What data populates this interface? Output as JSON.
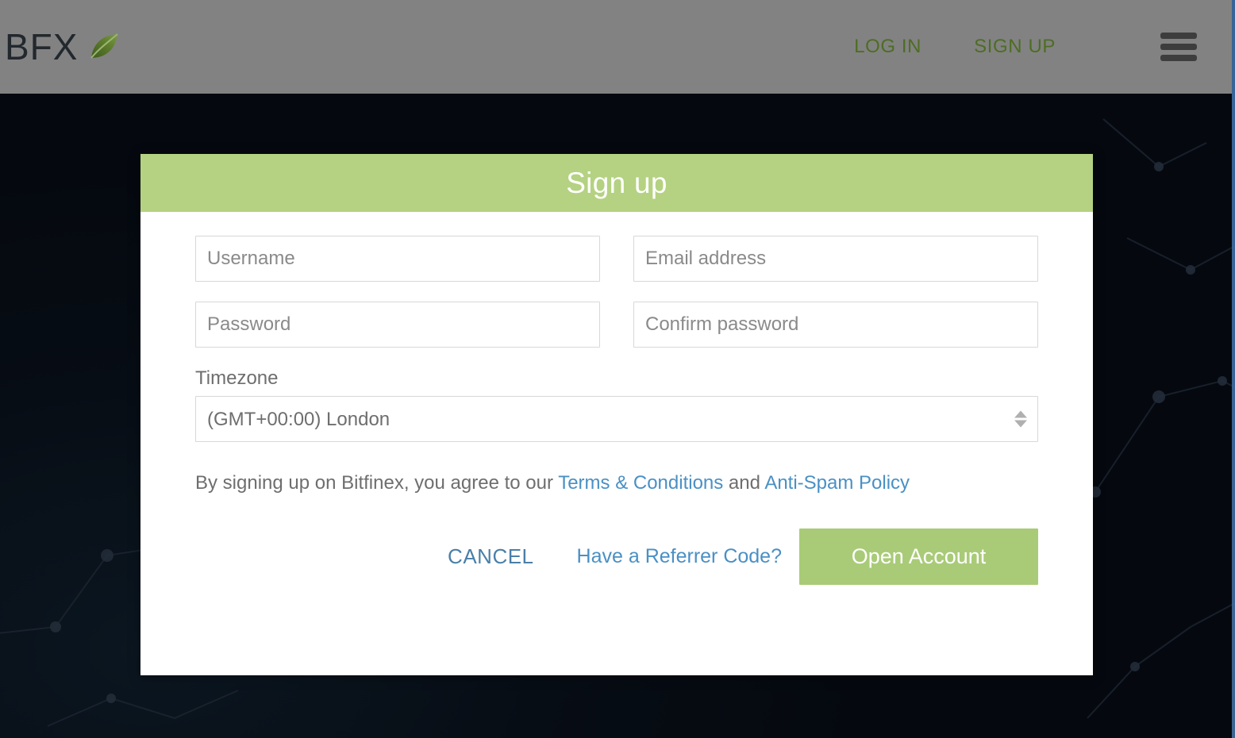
{
  "topbar": {
    "brand_text": "BFX",
    "brand_leaf_icon": "leaf-icon",
    "login_label": "LOG IN",
    "signup_label": "SIGN UP",
    "menu_icon": "hamburger-menu-icon",
    "background_color": "#828282",
    "link_color": "#4e6d23"
  },
  "modal": {
    "title": "Sign up",
    "header_color": "#b4d281",
    "fields": {
      "username_placeholder": "Username",
      "username_value": "",
      "email_placeholder": "Email address",
      "email_value": "",
      "password_placeholder": "Password",
      "password_value": "",
      "confirm_password_placeholder": "Confirm password",
      "confirm_password_value": "",
      "timezone_label": "Timezone",
      "timezone_value": "(GMT+00:00) London",
      "timezone_options": [
        "(GMT+00:00) London"
      ]
    },
    "terms": {
      "text_before": "By signing up on Bitfinex, you agree to our ",
      "terms_link": "Terms & Conditions",
      "text_between": " and ",
      "antispam_link": "Anti-Spam Policy",
      "link_color": "#4a90c4"
    },
    "actions": {
      "cancel_label": "CANCEL",
      "referrer_label": "Have a Referrer Code?",
      "open_account_label": "Open Account",
      "open_account_color": "#a9cb78"
    }
  },
  "background": {
    "base_color": "#060c14",
    "accent_edge_color": "#3d6ea8"
  }
}
